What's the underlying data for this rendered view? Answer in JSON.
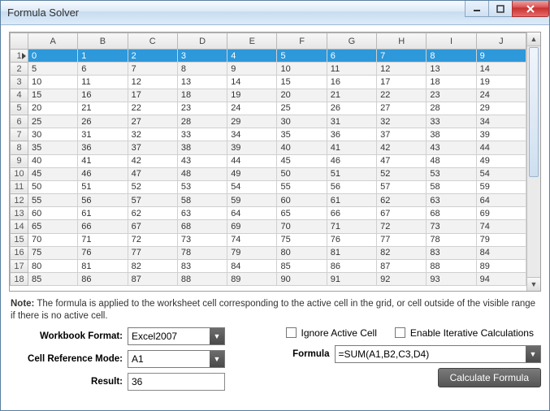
{
  "window": {
    "title": "Formula Solver"
  },
  "grid": {
    "columns": [
      "A",
      "B",
      "C",
      "D",
      "E",
      "F",
      "G",
      "H",
      "I",
      "J"
    ],
    "row_headers": [
      "1",
      "2",
      "3",
      "4",
      "5",
      "6",
      "7",
      "8",
      "9",
      "10",
      "11",
      "12",
      "13",
      "14",
      "15",
      "16",
      "17",
      "18"
    ],
    "active_row_index": 0,
    "rows": [
      [
        "0",
        "1",
        "2",
        "3",
        "4",
        "5",
        "6",
        "7",
        "8",
        "9"
      ],
      [
        "5",
        "6",
        "7",
        "8",
        "9",
        "10",
        "11",
        "12",
        "13",
        "14"
      ],
      [
        "10",
        "11",
        "12",
        "13",
        "14",
        "15",
        "16",
        "17",
        "18",
        "19"
      ],
      [
        "15",
        "16",
        "17",
        "18",
        "19",
        "20",
        "21",
        "22",
        "23",
        "24"
      ],
      [
        "20",
        "21",
        "22",
        "23",
        "24",
        "25",
        "26",
        "27",
        "28",
        "29"
      ],
      [
        "25",
        "26",
        "27",
        "28",
        "29",
        "30",
        "31",
        "32",
        "33",
        "34"
      ],
      [
        "30",
        "31",
        "32",
        "33",
        "34",
        "35",
        "36",
        "37",
        "38",
        "39"
      ],
      [
        "35",
        "36",
        "37",
        "38",
        "39",
        "40",
        "41",
        "42",
        "43",
        "44"
      ],
      [
        "40",
        "41",
        "42",
        "43",
        "44",
        "45",
        "46",
        "47",
        "48",
        "49"
      ],
      [
        "45",
        "46",
        "47",
        "48",
        "49",
        "50",
        "51",
        "52",
        "53",
        "54"
      ],
      [
        "50",
        "51",
        "52",
        "53",
        "54",
        "55",
        "56",
        "57",
        "58",
        "59"
      ],
      [
        "55",
        "56",
        "57",
        "58",
        "59",
        "60",
        "61",
        "62",
        "63",
        "64"
      ],
      [
        "60",
        "61",
        "62",
        "63",
        "64",
        "65",
        "66",
        "67",
        "68",
        "69"
      ],
      [
        "65",
        "66",
        "67",
        "68",
        "69",
        "70",
        "71",
        "72",
        "73",
        "74"
      ],
      [
        "70",
        "71",
        "72",
        "73",
        "74",
        "75",
        "76",
        "77",
        "78",
        "79"
      ],
      [
        "75",
        "76",
        "77",
        "78",
        "79",
        "80",
        "81",
        "82",
        "83",
        "84"
      ],
      [
        "80",
        "81",
        "82",
        "83",
        "84",
        "85",
        "86",
        "87",
        "88",
        "89"
      ],
      [
        "85",
        "86",
        "87",
        "88",
        "89",
        "90",
        "91",
        "92",
        "93",
        "94"
      ]
    ]
  },
  "note": {
    "prefix": "Note:",
    "body": " The formula is applied to the worksheet cell corresponding to the active cell in the grid, or cell outside of the visible range if there is no active cell."
  },
  "form": {
    "workbook_format_label": "Workbook Format:",
    "workbook_format_value": "Excel2007",
    "cell_ref_label": "Cell Reference Mode:",
    "cell_ref_value": "A1",
    "result_label": "Result:",
    "result_value": "36",
    "ignore_active_cell_label": "Ignore Active Cell",
    "enable_iterative_label": "Enable Iterative Calculations",
    "formula_label": "Formula",
    "formula_value": "=SUM(A1,B2,C3,D4)",
    "calculate_button": "Calculate Formula"
  }
}
